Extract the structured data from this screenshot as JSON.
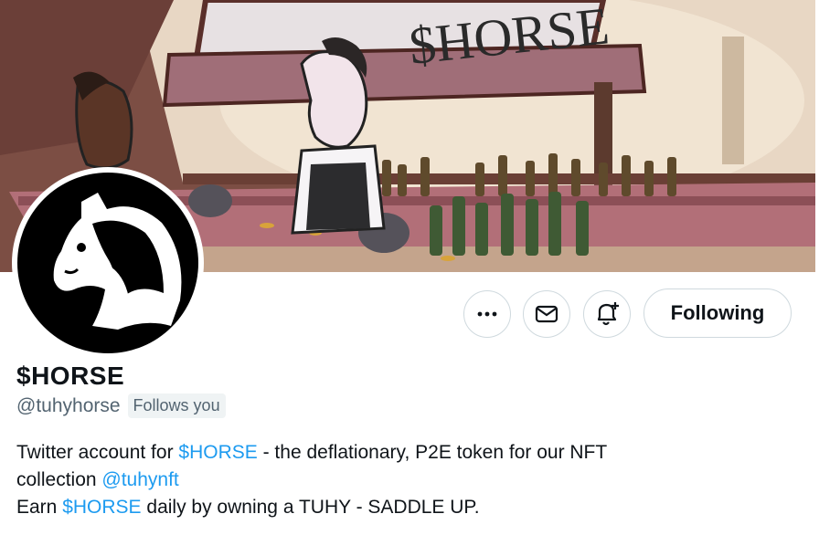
{
  "banner": {
    "sign_text": "$HORSE",
    "accent_colors": {
      "sky": "#e9d9c7",
      "wall": "#8a5a4d",
      "counter": "#b3707a"
    }
  },
  "profile": {
    "display_name": "$HORSE",
    "handle": "@tuhyhorse",
    "follows_you": "Follows you"
  },
  "actions": {
    "more_icon": "more-dots-icon",
    "message_icon": "envelope-icon",
    "notify_icon": "bell-plus-icon",
    "following_label": "Following"
  },
  "bio": {
    "line1_pre": "Twitter account for ",
    "line1_link": "$HORSE",
    "line1_post": " - the deflationary, P2E token for our NFT",
    "line2_pre": "collection ",
    "line2_link": "@tuhynft",
    "line3_pre": "Earn ",
    "line3_link": "$HORSE",
    "line3_post": " daily by owning a TUHY - SADDLE UP."
  },
  "colors": {
    "link": "#1d9bf0",
    "text": "#0f1419",
    "muted": "#536471",
    "border": "#cfd9de"
  }
}
